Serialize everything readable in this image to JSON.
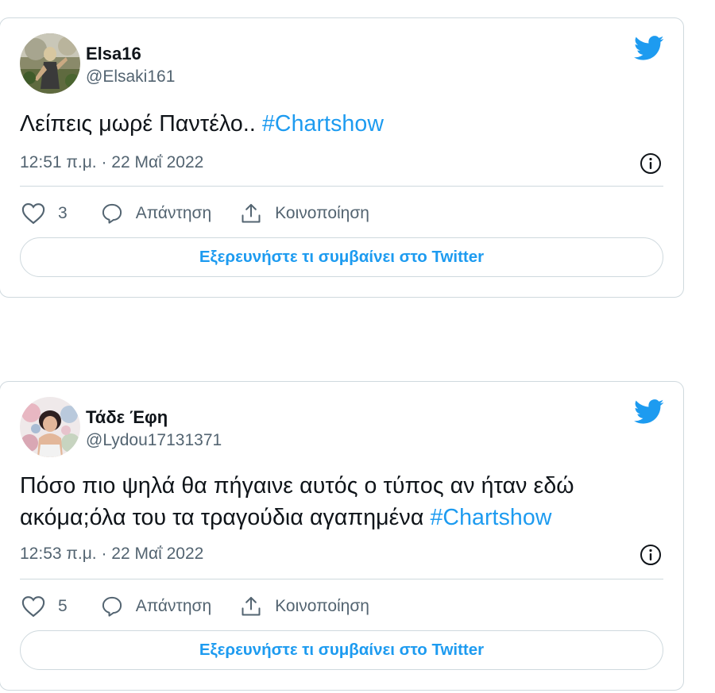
{
  "tweets": [
    {
      "author_name": "Elsa16",
      "author_handle": "@Elsaki161",
      "text": "Λείπεις μωρέ Παντέλο.. ",
      "hashtag": "#Chartshow",
      "timestamp": "12:51 π.μ. · 22 Μαΐ 2022",
      "like_count": "3",
      "reply_label": "Απάντηση",
      "share_label": "Κοινοποίηση",
      "explore_label": "Εξερευνήστε τι συμβαίνει στο Twitter"
    },
    {
      "author_name": "Τάδε Έφη",
      "author_handle": "@Lydou17131371",
      "text": "Πόσο πιο ψηλά θα πήγαινε αυτός ο τύπος αν ήταν εδώ ακόμα;όλα του τα τραγούδια αγαπημένα ",
      "hashtag": "#Chartshow",
      "timestamp": "12:53 π.μ. · 22 Μαΐ 2022",
      "like_count": "5",
      "reply_label": "Απάντηση",
      "share_label": "Κοινοποίηση",
      "explore_label": "Εξερευνήστε τι συμβαίνει στο Twitter"
    }
  ],
  "colors": {
    "accent": "#1d9bf0",
    "text_primary": "#0f1419",
    "text_secondary": "#536471",
    "border": "#cfd9de"
  },
  "icons": [
    "twitter-bird-icon",
    "heart-icon",
    "reply-icon",
    "share-icon",
    "info-icon"
  ]
}
